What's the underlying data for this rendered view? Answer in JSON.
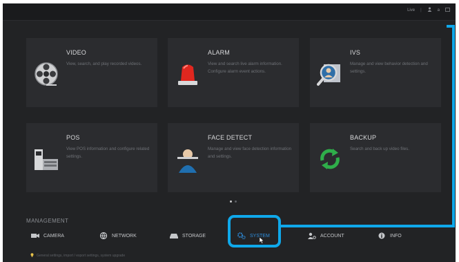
{
  "topbar": {
    "live_label": "Live",
    "user_label": "a",
    "win_label": "ɴ"
  },
  "tiles": [
    {
      "title": "VIDEO",
      "desc": "View, search, and play recorded videos.",
      "icon": "film-reel-icon"
    },
    {
      "title": "ALARM",
      "desc": "View and search live alarm information. Configure alarm event actions.",
      "icon": "alarm-siren-icon"
    },
    {
      "title": "IVS",
      "desc": "Manage and view behavior detection and settings.",
      "icon": "magnifier-person-icon"
    },
    {
      "title": "POS",
      "desc": "View POS information and configure related settings.",
      "icon": "pos-terminal-icon"
    },
    {
      "title": "FACE DETECT",
      "desc": "Manage and view face detection information and settings.",
      "icon": "face-scan-icon"
    },
    {
      "title": "BACKUP",
      "desc": "Search and back up video files.",
      "icon": "backup-arrows-icon"
    }
  ],
  "management": {
    "title": "MANAGEMENT",
    "items": [
      {
        "label": "CAMERA",
        "icon": "camera-icon"
      },
      {
        "label": "NETWORK",
        "icon": "network-globe-icon"
      },
      {
        "label": "STORAGE",
        "icon": "storage-drive-icon"
      },
      {
        "label": "SYSTEM",
        "icon": "gears-icon"
      },
      {
        "label": "ACCOUNT",
        "icon": "account-gear-icon"
      },
      {
        "label": "INFO",
        "icon": "info-icon"
      }
    ]
  },
  "footer_hint": "General settings, import / export settings, system upgrade",
  "colors": {
    "highlight": "#0fa8ea",
    "active": "#2e8fe0",
    "background": "#222325",
    "tile": "#2b2c2f"
  }
}
